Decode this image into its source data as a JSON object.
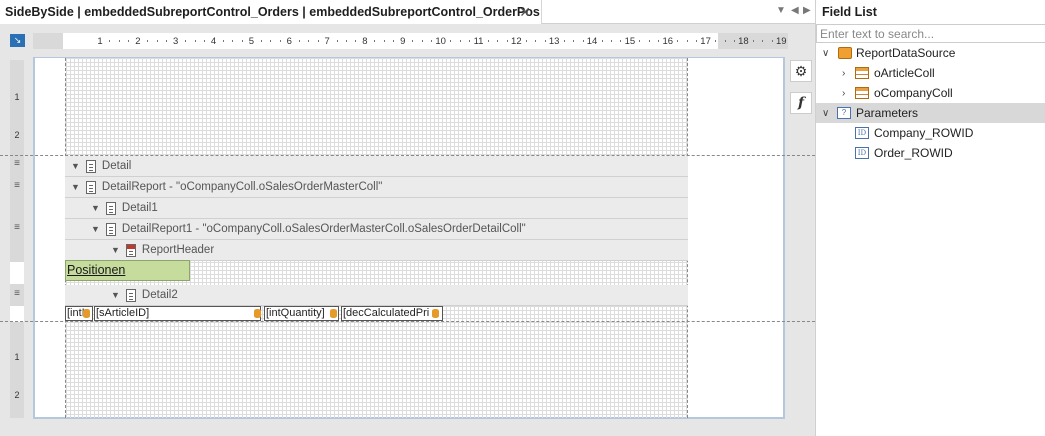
{
  "tab": {
    "title": "SideBySide | embeddedSubreportControl_Orders | embeddedSubreportControl_OrderPos",
    "close": "✕",
    "nav_down": "▼",
    "nav_left": "◀",
    "nav_right": "▶"
  },
  "ruler": {
    "corner_glyph": "↘",
    "h_ticks": [
      "1",
      "2",
      "3",
      "4",
      "5",
      "6",
      "7",
      "8",
      "9",
      "10",
      "11",
      "12",
      "13",
      "14",
      "15",
      "16",
      "17",
      "18",
      "19"
    ],
    "v_ticks": [
      "1",
      "2",
      "≡",
      "≡",
      "≡",
      "≡",
      "1",
      "2"
    ]
  },
  "bands": [
    {
      "label": "Detail",
      "icon": "band-icon"
    },
    {
      "label": "DetailReport - \"oCompanyColl.oSalesOrderMasterColl\"",
      "icon": "band-icon"
    },
    {
      "label": "Detail1",
      "icon": "band-icon"
    },
    {
      "label": "DetailReport1 - \"oCompanyColl.oSalesOrderMasterColl.oSalesOrderDetailColl\"",
      "icon": "band-icon"
    },
    {
      "label": "ReportHeader",
      "icon": "report-header-icon"
    },
    {
      "label": "Detail2",
      "icon": "band-icon"
    }
  ],
  "controls": {
    "positionen": "Positionen",
    "fields": [
      "[intI",
      "[sArticleID]",
      "[intQuantity]",
      "[decCalculatedPri"
    ]
  },
  "side_buttons": {
    "settings": "⚙",
    "function": "f"
  },
  "field_list": {
    "title": "Field List",
    "search_placeholder": "Enter text to search...",
    "items": [
      {
        "label": "ReportDataSource",
        "icon": "datasource-icon",
        "expander": "expanded"
      },
      {
        "label": "oArticleColl",
        "icon": "table-icon",
        "expander": "collapsed"
      },
      {
        "label": "oCompanyColl",
        "icon": "table-icon",
        "expander": "collapsed"
      },
      {
        "label": "Parameters",
        "icon": "parameters-icon",
        "expander": "expanded",
        "selected": true
      },
      {
        "label": "Company_ROWID",
        "icon": "id-parameter-icon"
      },
      {
        "label": "Order_ROWID",
        "icon": "id-parameter-icon"
      }
    ]
  },
  "colors": {
    "positionen_fill": "#c5dc9d",
    "band_fill": "#ebebeb",
    "ruler_corner": "#2b6fb5",
    "db_icon": "#e69a2a"
  }
}
